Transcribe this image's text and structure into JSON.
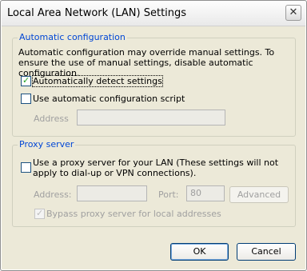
{
  "window": {
    "title": "Local Area Network (LAN) Settings",
    "close_glyph": "✕"
  },
  "auto_config": {
    "legend": "Automatic configuration",
    "description": "Automatic configuration may override manual settings.  To ensure the use of manual settings, disable automatic configuration.",
    "auto_detect": {
      "label": "Automatically detect settings",
      "checked": true
    },
    "use_script": {
      "label": "Use automatic configuration script",
      "checked": false
    },
    "address_label": "Address",
    "address_value": ""
  },
  "proxy": {
    "legend": "Proxy server",
    "use_proxy": {
      "label": "Use a proxy server for your LAN (These settings will not apply to dial-up or VPN connections).",
      "checked": false
    },
    "address_label": "Address:",
    "address_value": "",
    "port_label": "Port:",
    "port_value": "80",
    "advanced_label": "Advanced",
    "bypass": {
      "label": "Bypass proxy server for local addresses",
      "checked": true
    }
  },
  "buttons": {
    "ok": "OK",
    "cancel": "Cancel"
  },
  "colors": {
    "legend": "#0046d5",
    "face": "#ece9d8",
    "check_mark": "#21a121"
  }
}
